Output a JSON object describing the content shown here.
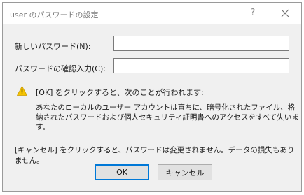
{
  "dialog": {
    "title": "user のパスワードの設定",
    "help_glyph": "?",
    "new_password_label": "新しいパスワード(N):",
    "new_password_value": "",
    "confirm_password_label": "パスワードの確認入力(C):",
    "confirm_password_value": "",
    "warning_title": "[OK] をクリックすると、次のことが行われます:",
    "warning_body": "あなたのローカルのユーザー アカウントは直ちに、暗号化されたファイル、格納されたパスワードおよび個人セキュリティ証明書へのアクセスをすべて失います。",
    "cancel_note": "[キャンセル] をクリックすると、パスワードは変更されません。データの損失もありません。",
    "ok_label": "OK",
    "cancel_label": "キャンセル"
  },
  "icons": {
    "warning": "warning-icon",
    "close": "close-icon",
    "help": "help-icon"
  },
  "colors": {
    "warning_yellow": "#f6c400",
    "default_button_border": "#0078d7"
  }
}
